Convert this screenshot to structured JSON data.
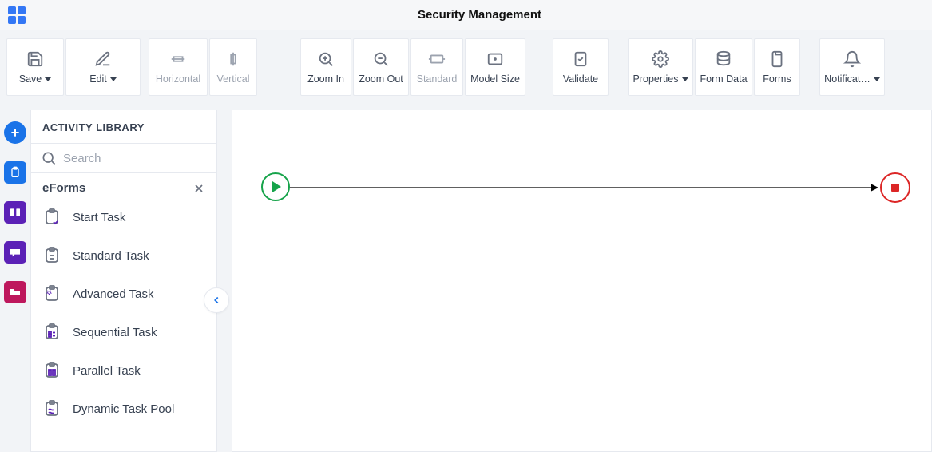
{
  "header": {
    "title": "Security Management"
  },
  "toolbar": {
    "save_label": "Save",
    "edit_label": "Edit",
    "horizontal_label": "Horizontal",
    "vertical_label": "Vertical",
    "zoomin_label": "Zoom In",
    "zoomout_label": "Zoom Out",
    "standard_label": "Standard",
    "modelsize_label": "Model Size",
    "validate_label": "Validate",
    "properties_label": "Properties",
    "formdata_label": "Form Data",
    "forms_label": "Forms",
    "notifications_label": "Notificat…"
  },
  "panel": {
    "title": "ACTIVITY LIBRARY",
    "search_placeholder": "Search",
    "category": "eForms",
    "items": [
      {
        "label": "Start Task"
      },
      {
        "label": "Standard Task"
      },
      {
        "label": "Advanced Task"
      },
      {
        "label": "Sequential Task"
      },
      {
        "label": "Parallel Task"
      },
      {
        "label": "Dynamic Task Pool"
      }
    ]
  }
}
